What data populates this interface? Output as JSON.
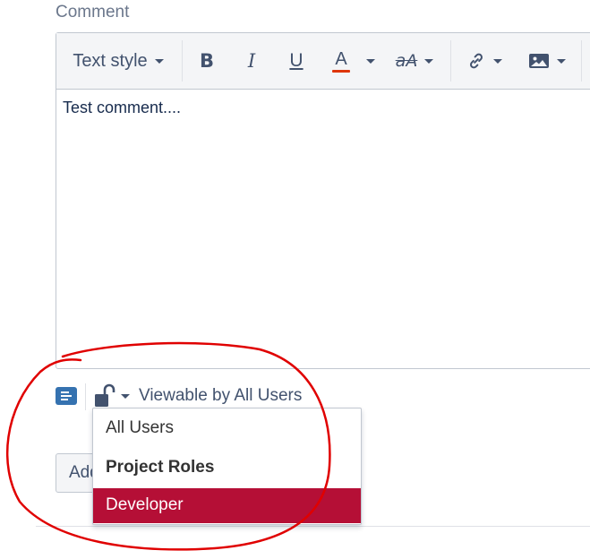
{
  "field": {
    "label": "Comment"
  },
  "toolbar": {
    "text_style_label": "Text style",
    "bold_glyph": "B",
    "italic_glyph": "I",
    "underline_glyph": "U",
    "color_glyph": "A",
    "more_format_glyph": "aA",
    "color_accent": "#de350b",
    "icons": [
      "link-icon",
      "image-icon"
    ]
  },
  "editor": {
    "content": "Test comment...."
  },
  "security": {
    "icons": [
      "wiki-renderer-icon",
      "unlock-icon"
    ],
    "label": "Viewable by All Users",
    "options": [
      {
        "label": "All Users",
        "type": "option"
      },
      {
        "label": "Project Roles",
        "type": "heading"
      },
      {
        "label": "Developer",
        "type": "option",
        "selected": true
      }
    ],
    "selected_color": "#b50f36"
  },
  "actions": {
    "add_label": "Add"
  },
  "annotation": {
    "color": "#e00000"
  }
}
